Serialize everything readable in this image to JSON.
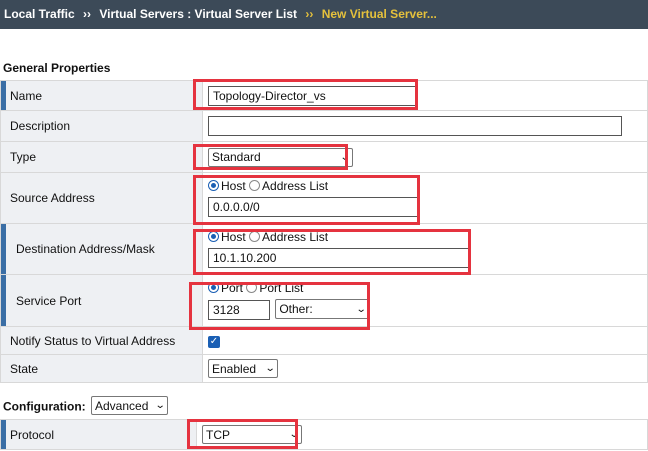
{
  "breadcrumb": {
    "local_traffic": "Local Traffic",
    "sep": "››",
    "virtual_servers": "Virtual Servers : Virtual Server List",
    "current": "New Virtual Server..."
  },
  "section_general": "General Properties",
  "fields": {
    "name": {
      "label": "Name",
      "value": "Topology-Director_vs"
    },
    "description": {
      "label": "Description",
      "value": ""
    },
    "type": {
      "label": "Type",
      "value": "Standard"
    },
    "source_address": {
      "label": "Source Address",
      "option_host": "Host",
      "option_list": "Address List",
      "value": "0.0.0.0/0"
    },
    "destination": {
      "label": "Destination Address/Mask",
      "option_host": "Host",
      "option_list": "Address List",
      "value": "10.1.10.200"
    },
    "service_port": {
      "label": "Service Port",
      "option_port": "Port",
      "option_list": "Port List",
      "value": "3128",
      "select": "Other:"
    },
    "notify": {
      "label": "Notify Status to Virtual Address",
      "checked": true
    },
    "state": {
      "label": "State",
      "value": "Enabled"
    }
  },
  "configuration": {
    "label": "Configuration:",
    "value": "Advanced"
  },
  "protocol": {
    "label": "Protocol",
    "value": "TCP"
  },
  "colors": {
    "topbar": "#3c4a58",
    "accent": "#e5c13c",
    "highlight": "#e5333f",
    "required_bar": "#3a6ea5"
  }
}
